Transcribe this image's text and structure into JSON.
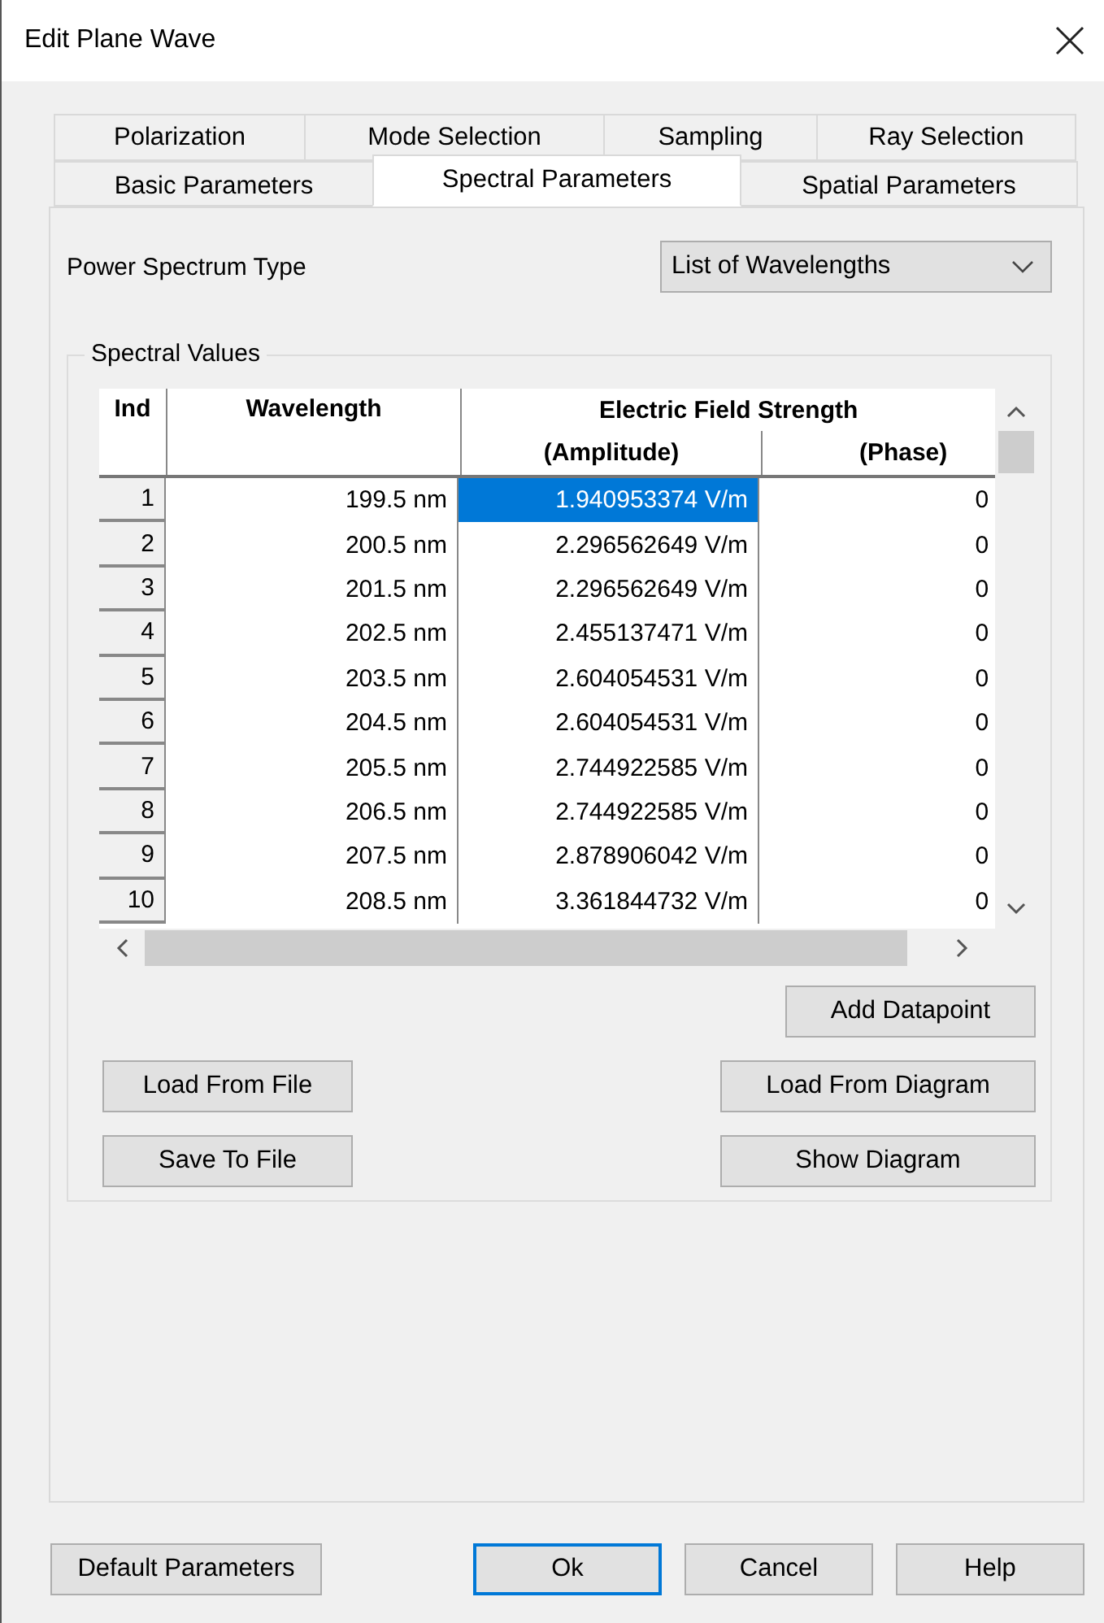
{
  "window": {
    "title": "Edit Plane Wave"
  },
  "tab_rows": [
    [
      {
        "label": "Polarization",
        "selected": false
      },
      {
        "label": "Mode Selection",
        "selected": false
      },
      {
        "label": "Sampling",
        "selected": false
      },
      {
        "label": "Ray Selection",
        "selected": false
      }
    ],
    [
      {
        "label": "Basic Parameters",
        "selected": false
      },
      {
        "label": "Spectral Parameters",
        "selected": true
      },
      {
        "label": "Spatial Parameters",
        "selected": false
      }
    ]
  ],
  "power_spectrum_type": {
    "label": "Power Spectrum Type",
    "value": "List of Wavelengths"
  },
  "spectral_values": {
    "title": "Spectral Values",
    "columns": {
      "index": "Ind",
      "wavelength": "Wavelength",
      "group": "Electric Field Strength",
      "amplitude": "(Amplitude)",
      "phase": "(Phase)"
    },
    "rows": [
      {
        "index": "1",
        "wavelength": "199.5 nm",
        "amplitude": "1.940953374 V/m",
        "phase": "0",
        "selected": true
      },
      {
        "index": "2",
        "wavelength": "200.5 nm",
        "amplitude": "2.296562649 V/m",
        "phase": "0",
        "selected": false
      },
      {
        "index": "3",
        "wavelength": "201.5 nm",
        "amplitude": "2.296562649 V/m",
        "phase": "0",
        "selected": false
      },
      {
        "index": "4",
        "wavelength": "202.5 nm",
        "amplitude": "2.455137471 V/m",
        "phase": "0",
        "selected": false
      },
      {
        "index": "5",
        "wavelength": "203.5 nm",
        "amplitude": "2.604054531 V/m",
        "phase": "0",
        "selected": false
      },
      {
        "index": "6",
        "wavelength": "204.5 nm",
        "amplitude": "2.604054531 V/m",
        "phase": "0",
        "selected": false
      },
      {
        "index": "7",
        "wavelength": "205.5 nm",
        "amplitude": "2.744922585 V/m",
        "phase": "0",
        "selected": false
      },
      {
        "index": "8",
        "wavelength": "206.5 nm",
        "amplitude": "2.744922585 V/m",
        "phase": "0",
        "selected": false
      },
      {
        "index": "9",
        "wavelength": "207.5 nm",
        "amplitude": "2.878906042 V/m",
        "phase": "0",
        "selected": false
      },
      {
        "index": "10",
        "wavelength": "208.5 nm",
        "amplitude": "3.361844732 V/m",
        "phase": "0",
        "selected": false
      }
    ],
    "add_button": "Add Datapoint",
    "left_buttons": [
      "Load From File",
      "Save To File"
    ],
    "right_buttons": [
      "Load From Diagram",
      "Show Diagram"
    ]
  },
  "footer": {
    "left_button": "Default Parameters",
    "buttons": [
      {
        "label": "Ok",
        "default": true
      },
      {
        "label": "Cancel",
        "default": false
      },
      {
        "label": "Help",
        "default": false
      }
    ]
  }
}
